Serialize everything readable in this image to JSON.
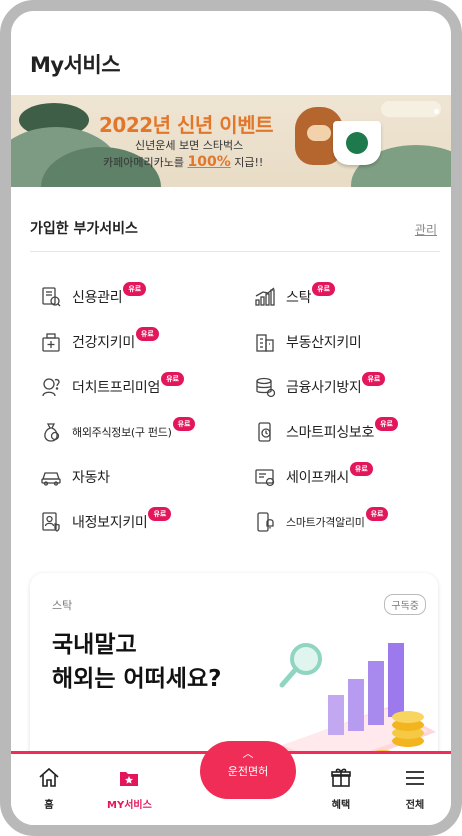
{
  "header": {
    "title": "My서비스"
  },
  "banner": {
    "headline": "2022년 신년 이벤트",
    "line1": "신년운세 보면 스타벅스",
    "line2_before": "카페아메리카노를 ",
    "line2_highlight": "100%",
    "line2_after": " 지급!!"
  },
  "subscribed": {
    "title": "가입한 부가서비스",
    "manage_label": "관리",
    "badge_label": "유료",
    "items": [
      {
        "label": "신용관리",
        "icon": "credit-report-icon",
        "paid": true
      },
      {
        "label": "스탁",
        "icon": "stock-chart-icon",
        "paid": true
      },
      {
        "label": "건강지키미",
        "icon": "health-kit-icon",
        "paid": true
      },
      {
        "label": "부동산지키미",
        "icon": "building-icon",
        "paid": false
      },
      {
        "label": "더치트프리미엄",
        "icon": "person-question-icon",
        "paid": true
      },
      {
        "label": "금융사기방지",
        "icon": "coin-stack-icon",
        "paid": true
      },
      {
        "label": "해외주식정보(구 펀드)",
        "icon": "money-bag-icon",
        "paid": true
      },
      {
        "label": "스마트피싱보호",
        "icon": "phone-shield-icon",
        "paid": true
      },
      {
        "label": "자동차",
        "icon": "car-icon",
        "paid": false
      },
      {
        "label": "세이프캐시",
        "icon": "safe-cash-icon",
        "paid": true
      },
      {
        "label": "내정보지키미",
        "icon": "id-shield-icon",
        "paid": true
      },
      {
        "label": "스마트가격알리미",
        "icon": "phone-bell-icon",
        "paid": true
      }
    ]
  },
  "promo": {
    "category": "스탁",
    "subscribe_label": "구독중",
    "headline_line1": "국내말고",
    "headline_line2": "해외는 어떠세요?"
  },
  "nav": {
    "home": "홈",
    "my_services": "MY서비스",
    "drive": "운전면허",
    "benefits": "혜택",
    "all": "전체"
  },
  "colors": {
    "accent": "#e3165b",
    "nav_accent": "#ef2d56",
    "banner_orange": "#e2772b"
  }
}
